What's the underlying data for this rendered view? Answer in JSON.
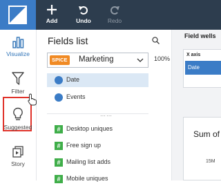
{
  "toolbar": {
    "add_label": "Add",
    "undo_label": "Undo",
    "redo_label": "Redo"
  },
  "rail": {
    "items": [
      {
        "label": "Visualize",
        "icon": "bar-chart-icon"
      },
      {
        "label": "Filter",
        "icon": "funnel-icon"
      },
      {
        "label": "Suggested",
        "icon": "lightbulb-icon"
      },
      {
        "label": "Story",
        "icon": "story-icon"
      }
    ]
  },
  "fields_panel": {
    "title": "Fields list",
    "dataset": {
      "badge": "SPICE",
      "name": "Marketing"
    },
    "spice_usage": "100%",
    "fields": [
      {
        "label": "Date",
        "type": "dimension"
      },
      {
        "label": "Events",
        "type": "dimension"
      },
      {
        "label": "Desktop uniques",
        "type": "measure"
      },
      {
        "label": "Free sign up",
        "type": "measure"
      },
      {
        "label": "Mailing list adds",
        "type": "measure"
      },
      {
        "label": "Mobile uniques",
        "type": "measure"
      }
    ]
  },
  "field_wells": {
    "title": "Field wells",
    "x_axis_label": "X axis",
    "x_axis_value": "Date"
  },
  "visual": {
    "title_partial": "Sum of",
    "tick": "15M"
  },
  "colors": {
    "toolbar_bg": "#2d3d4e",
    "accent_blue": "#3b7cc6",
    "measure_green": "#3fae49",
    "spice_orange": "#f08a24",
    "highlight_red": "#e0322a"
  }
}
